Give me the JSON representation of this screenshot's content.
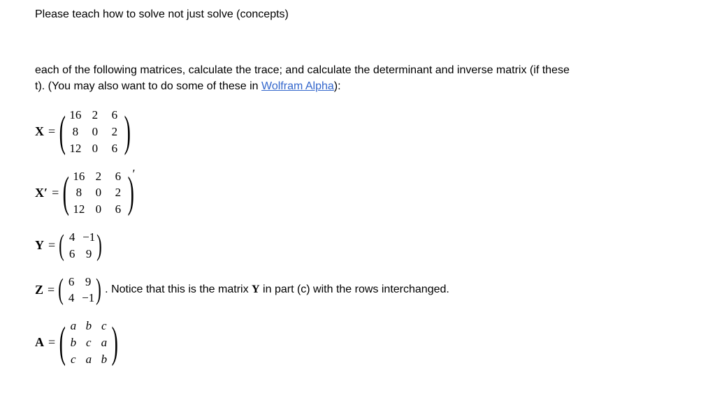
{
  "topInstruction": "Please teach how to solve not just solve (concepts)",
  "problem": {
    "line1": "each of the following matrices, calculate the trace; and calculate the determinant and inverse matrix (if these",
    "line2a": "t). (You may also want to do some of these in ",
    "link": "Wolfram Alpha",
    "line2b": "):"
  },
  "matrices": {
    "X": {
      "label": "X",
      "rows": [
        [
          "16",
          "2",
          "6"
        ],
        [
          "8",
          "0",
          "2"
        ],
        [
          "12",
          "0",
          "6"
        ]
      ]
    },
    "Xprime": {
      "label": "X′",
      "rows": [
        [
          "16",
          "2",
          "6"
        ],
        [
          "8",
          "0",
          "2"
        ],
        [
          "12",
          "0",
          "6"
        ]
      ]
    },
    "Y": {
      "label": "Y",
      "rows": [
        [
          "4",
          "−1"
        ],
        [
          "6",
          "9"
        ]
      ]
    },
    "Z": {
      "label": "Z",
      "rows": [
        [
          "6",
          "9"
        ],
        [
          "4",
          "−1"
        ]
      ],
      "notice1": ". Notice that this is the matrix ",
      "noticeBold": "Y",
      "notice2": " in part (c) with the rows interchanged."
    },
    "A": {
      "label": "A",
      "rows": [
        [
          "a",
          "b",
          "c"
        ],
        [
          "b",
          "c",
          "a"
        ],
        [
          "c",
          "a",
          "b"
        ]
      ]
    }
  }
}
